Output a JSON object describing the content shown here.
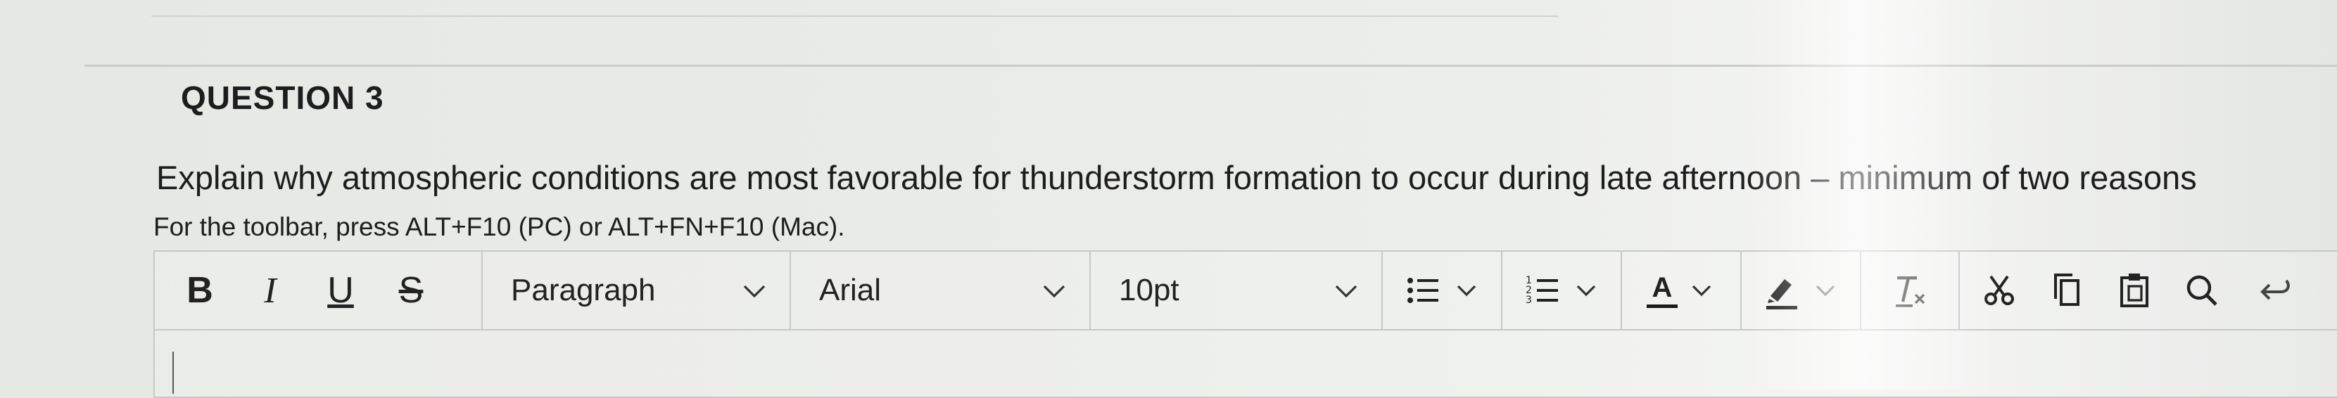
{
  "question": {
    "heading": "QUESTION 3",
    "text": "Explain why atmospheric conditions are most favorable for thunderstorm formation to occur during late afternoon – minimum of two reasons"
  },
  "editor": {
    "hint": "For the toolbar, press ALT+F10 (PC) or ALT+FN+F10 (Mac).",
    "toolbar": {
      "bold": "B",
      "italic": "I",
      "underline": "U",
      "strikethrough": "S",
      "block_format": "Paragraph",
      "font_family": "Arial",
      "font_size": "10pt",
      "text_color_glyph": "A"
    },
    "icons": {
      "bullet_list": "bullet-list-icon",
      "numbered_list": "numbered-list-icon",
      "text_color": "text-color-icon",
      "highlight": "highlighter-icon",
      "clear_format": "clear-formatting-icon",
      "cut": "scissors-icon",
      "copy": "copy-icon",
      "paste": "clipboard-icon",
      "find": "magnifier-icon",
      "undo": "undo-icon"
    },
    "colors": {
      "text_color_bar": "#1a1a1a",
      "highlight_bar": "#1a1a1a",
      "border": "#c5c8c4"
    }
  }
}
